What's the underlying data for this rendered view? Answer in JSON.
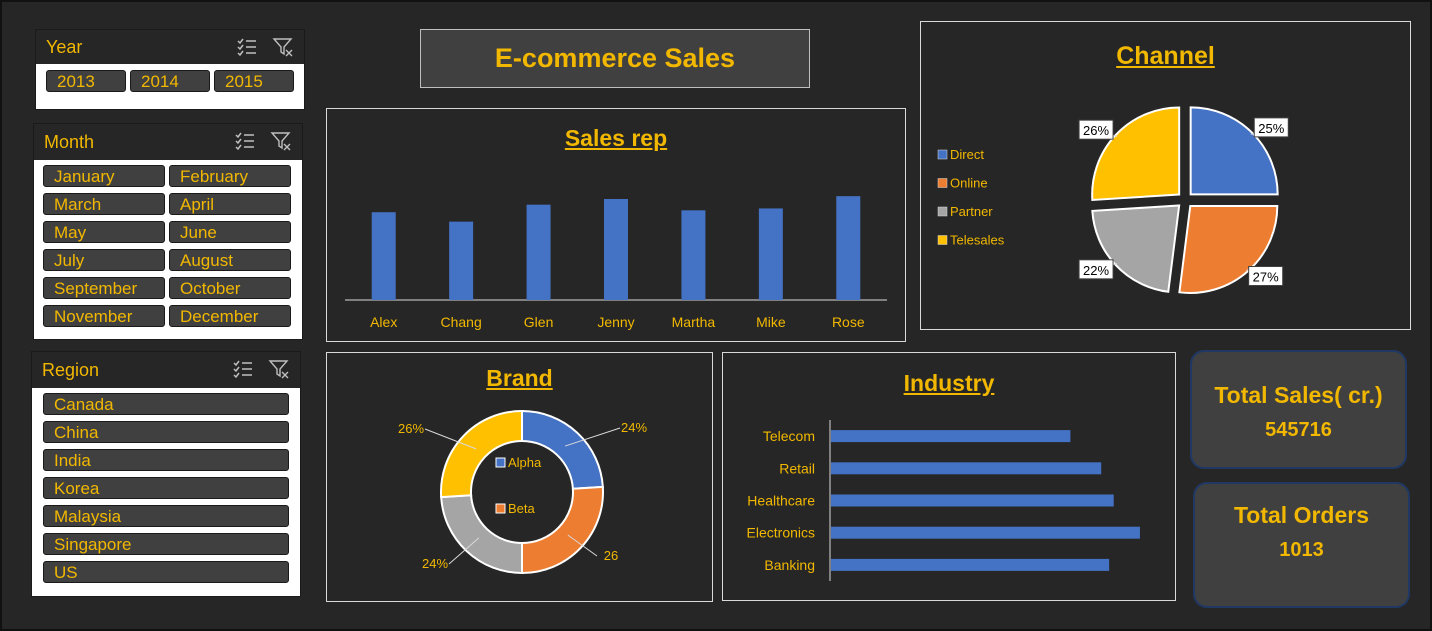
{
  "dashboard_title": "E-commerce Sales",
  "slicers": {
    "year": {
      "title": "Year",
      "items": [
        "2013",
        "2014",
        "2015"
      ]
    },
    "month": {
      "title": "Month",
      "items": [
        "January",
        "February",
        "March",
        "April",
        "May",
        "June",
        "July",
        "August",
        "September",
        "October",
        "November",
        "December"
      ]
    },
    "region": {
      "title": "Region",
      "items": [
        "Canada",
        "China",
        "India",
        "Korea",
        "Malaysia",
        "Singapore",
        "US"
      ]
    }
  },
  "colors": {
    "accent": "#f2b800",
    "blue": "#4472c4",
    "orange": "#ed7d31",
    "gray": "#a5a5a5",
    "yellow": "#ffc000",
    "background": "#262626"
  },
  "kpis": {
    "total_sales": {
      "label": "Total Sales( cr.)",
      "value": "545716"
    },
    "total_orders": {
      "label": "Total Orders",
      "value": "1013"
    }
  },
  "chart_data": [
    {
      "type": "bar",
      "title": "Sales rep",
      "categories": [
        "Alex",
        "Chang",
        "Glen",
        "Jenny",
        "Martha",
        "Mike",
        "Rose"
      ],
      "values": [
        93,
        83,
        101,
        107,
        95,
        97,
        110
      ],
      "ylim": [
        0,
        125
      ],
      "grid": false
    },
    {
      "type": "pie",
      "title": "Channel",
      "categories": [
        "Direct",
        "Online",
        "Partner",
        "Telesales"
      ],
      "values": [
        25,
        27,
        22,
        26
      ],
      "labels": [
        "25%",
        "27%",
        "22%",
        "26%"
      ],
      "legend": "left",
      "exploded": true
    },
    {
      "type": "pie",
      "subtype": "donut",
      "title": "Brand",
      "categories": [
        "Alpha",
        "Beta"
      ],
      "values": [
        24,
        26,
        24,
        26
      ],
      "labels": [
        "24%",
        "26",
        "24%",
        "26%"
      ],
      "legend": "center"
    },
    {
      "type": "bar",
      "orientation": "horizontal",
      "title": "Industry",
      "categories": [
        "Telecom",
        "Retail",
        "Healthcare",
        "Electronics",
        "Banking"
      ],
      "values": [
        210,
        237,
        248,
        271,
        244
      ],
      "xlim": [
        0,
        300
      ],
      "grid": false
    }
  ]
}
